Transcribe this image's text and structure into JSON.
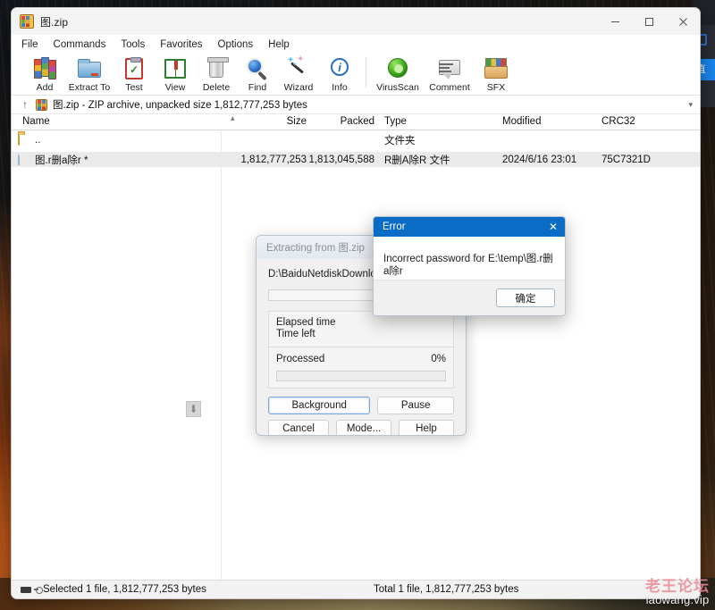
{
  "window": {
    "title": "图.zip",
    "app_icon": "winrar-books-icon",
    "controls": {
      "minimize": "minimize-icon",
      "maximize": "maximize-icon",
      "close": "close-icon"
    }
  },
  "menubar": {
    "items": [
      {
        "label": "File"
      },
      {
        "label": "Commands"
      },
      {
        "label": "Tools"
      },
      {
        "label": "Favorites"
      },
      {
        "label": "Options"
      },
      {
        "label": "Help"
      }
    ]
  },
  "toolbar": {
    "items": [
      {
        "label": "Add",
        "icon": "add-archive-icon"
      },
      {
        "label": "Extract To",
        "icon": "extract-folder-icon"
      },
      {
        "label": "Test",
        "icon": "test-clipboard-icon"
      },
      {
        "label": "View",
        "icon": "view-book-icon"
      },
      {
        "label": "Delete",
        "icon": "delete-trash-icon"
      },
      {
        "label": "Find",
        "icon": "find-magnifier-icon"
      },
      {
        "label": "Wizard",
        "icon": "wizard-wand-icon"
      },
      {
        "label": "Info",
        "icon": "info-circle-icon"
      }
    ],
    "items2": [
      {
        "label": "VirusScan",
        "icon": "virusscan-shield-icon"
      },
      {
        "label": "Comment",
        "icon": "comment-bubble-icon"
      },
      {
        "label": "SFX",
        "icon": "sfx-box-icon"
      }
    ]
  },
  "addressbar": {
    "up_icon": "up-arrow-icon",
    "archive_icon": "archive-icon",
    "text": "图.zip - ZIP archive, unpacked size 1,812,777,253 bytes",
    "chevron": "chevron-down-icon"
  },
  "filelist": {
    "columns": [
      {
        "label": "Name"
      },
      {
        "label": "Size"
      },
      {
        "label": "Packed"
      },
      {
        "label": "Type"
      },
      {
        "label": "Modified"
      },
      {
        "label": "CRC32"
      }
    ],
    "sort_indicator": "sort-ascending-caret",
    "rows": [
      {
        "icon": "folder-up-icon",
        "name": "..",
        "size": "",
        "packed": "",
        "type": "文件夹",
        "modified": "",
        "crc32": "",
        "selected": false
      },
      {
        "icon": "file-icon",
        "name": "图.r删a除r *",
        "size": "1,812,777,253",
        "packed": "1,813,045,588",
        "type": "R删A除R 文件",
        "modified": "2024/6/16 23:01",
        "crc32": "75C7321D",
        "selected": true
      }
    ]
  },
  "statusbar": {
    "left_icon_a": "drive-icon",
    "left_icon_b": "key-icon",
    "left_text": "Selected 1 file, 1,812,777,253 bytes",
    "right_text": "Total 1 file, 1,812,777,253 bytes"
  },
  "progress_dialog": {
    "title": "Extracting from 图.zip",
    "path": "D:\\BaiduNetdiskDownload\\图.zip",
    "elapsed_label": "Elapsed time",
    "elapsed_value": "",
    "timeleft_label": "Time left",
    "timeleft_value": "",
    "processed_label": "Processed",
    "processed_value": "0%",
    "buttons": {
      "background": "Background",
      "pause": "Pause",
      "cancel": "Cancel",
      "mode": "Mode...",
      "help": "Help"
    }
  },
  "error_dialog": {
    "title": "Error",
    "close_icon": "close-icon",
    "message": "Incorrect password for E:\\temp\\图.r删a除r",
    "ok_button": "确定"
  },
  "edge_app": {
    "button_label": "直"
  },
  "watermark": {
    "chinese": "老王论坛",
    "english": "laowang.vip"
  },
  "colors": {
    "error_titlebar": "#0a6cc4",
    "selection": "#eaeaea",
    "watermark_pink": "#e98a96"
  }
}
